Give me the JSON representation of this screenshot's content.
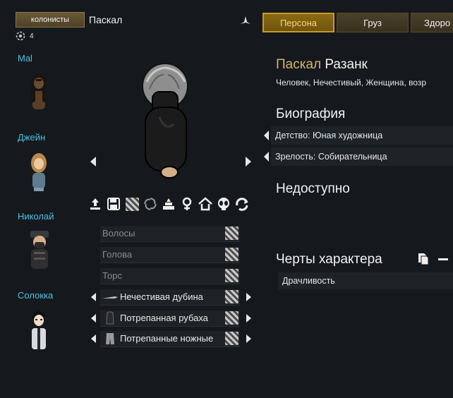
{
  "header": {
    "colonists_button": "колонисты",
    "pawn_name": "Паскал",
    "count": "4"
  },
  "colonists": [
    {
      "name": "Mal",
      "hair": "#1a1410",
      "skin": "#6b4a32",
      "body": "#5a3e2a"
    },
    {
      "name": "Джейн",
      "hair": "#b8894a",
      "skin": "#e9c9a2",
      "body": "#5e7a8c"
    },
    {
      "name": "Николай",
      "hair": "#3a3a3a",
      "skin": "#d9b08c",
      "body": "#2f2f2f"
    },
    {
      "name": "Солокка",
      "hair": "#101010",
      "skin": "#f2dcc6",
      "body": "#d7dbe0"
    }
  ],
  "tabs": [
    {
      "label": "Персона",
      "active": true
    },
    {
      "label": "Груз",
      "active": false
    },
    {
      "label": "Здоро",
      "active": false
    }
  ],
  "portrait": {
    "hair": "#8e8e8e",
    "skin": "#d3b08a",
    "outfit": "#1b1b1b"
  },
  "action_icons": [
    "drop-icon",
    "save-icon",
    "hatch-icon",
    "swirl-icon",
    "stack-icon",
    "female-icon",
    "home-icon",
    "alien-icon",
    "cycle-icon"
  ],
  "apparel": [
    {
      "label": "Волосы",
      "arrows": false
    },
    {
      "label": "Голова",
      "arrows": false
    },
    {
      "label": "Торс",
      "arrows": false
    },
    {
      "label": "Нечестивая дубина",
      "arrows": true,
      "icon": "club-icon"
    },
    {
      "label": "Потрепанная рубаха",
      "arrows": true,
      "icon": "shirt-icon"
    },
    {
      "label": "Потрепанные ножные",
      "arrows": true,
      "icon": "pants-icon"
    }
  ],
  "info": {
    "first_name": "Паскал",
    "last_name": "Разанк",
    "description": "Человек, Нечестивый, Женщина, возр",
    "biography_title": "Биография",
    "childhood": "Детство: Юная художница",
    "adulthood": "Зрелость: Собирательница",
    "unavailable_title": "Недоступно",
    "traits_title": "Черты характера",
    "traits": [
      "Драчливость"
    ]
  },
  "colors": {
    "background": "#15191d",
    "colonist_name": "#4ec1e0",
    "first_name": "#d8b36a",
    "tab_active": "#8a6a12",
    "tab_inactive": "#4a3f2a"
  }
}
